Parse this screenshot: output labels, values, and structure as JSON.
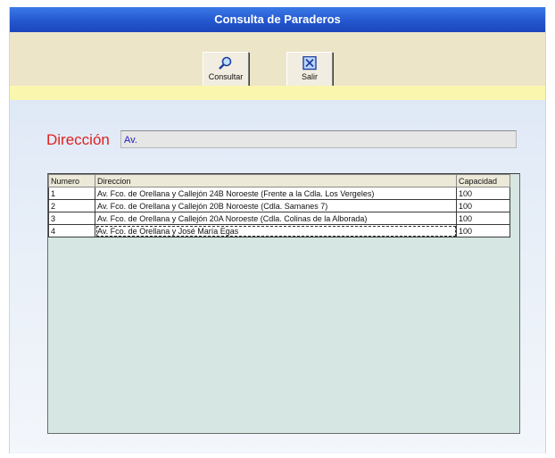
{
  "window": {
    "title": "Consulta de Paraderos"
  },
  "toolbar": {
    "consultar_label": "Consultar",
    "salir_label": "Salir",
    "consultar_icon": "magnifier-icon",
    "salir_icon": "exit-icon"
  },
  "search": {
    "label": "Dirección",
    "value": "Av."
  },
  "table": {
    "headers": [
      "Numero",
      "Direccion",
      "Capacidad"
    ],
    "rows": [
      [
        "1",
        "Av. Fco. de Orellana y Callejón 24B Noroeste (Frente a la Cdla. Los Vergeles)",
        "100"
      ],
      [
        "2",
        "Av. Fco. de Orellana y Callejón 20B Noroeste (Cdla. Samanes 7)",
        "100"
      ],
      [
        "3",
        "Av. Fco. de Orellana y Callejón 20A Noroeste (Cdla. Colinas de la Alborada)",
        "100"
      ],
      [
        "4",
        "Av. Fco. de Orellana y José María Egas",
        "100"
      ]
    ]
  },
  "colors": {
    "titlebar": "#2457cf",
    "toolbar": "#ece5c8",
    "band": "#fbf6ad",
    "label_red": "#e02020",
    "grid_bg": "#d6e6e2"
  }
}
